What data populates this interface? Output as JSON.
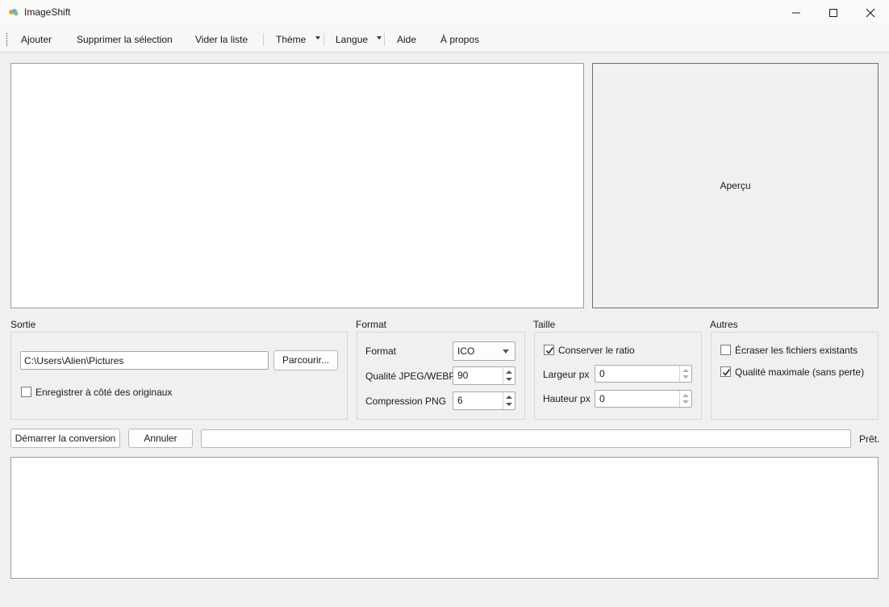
{
  "window": {
    "title": "ImageShift",
    "controls": [
      "minimize-icon",
      "maximize-icon",
      "close-icon"
    ]
  },
  "toolbar": {
    "add": "Ajouter",
    "remove_selection": "Supprimer la sélection",
    "clear_list": "Vider la liste",
    "theme": "Thème",
    "language": "Langue",
    "help": "Aide",
    "about": "À propos"
  },
  "preview": {
    "label": "Aperçu"
  },
  "output": {
    "group_label": "Sortie",
    "path": "C:\\Users\\Alien\\Pictures",
    "browse_label": "Parcourir...",
    "save_next_label": "Enregistrer à côté des originaux",
    "save_next_checked": false
  },
  "format": {
    "group_label": "Format",
    "format_label": "Format",
    "format_value": "ICO",
    "jpeg_quality_label": "Qualité JPEG/WEBP",
    "jpeg_quality_value": "90",
    "png_compression_label": "Compression PNG",
    "png_compression_value": "6"
  },
  "size": {
    "group_label": "Taille",
    "keep_ratio_label": "Conserver le ratio",
    "keep_ratio_checked": true,
    "width_label": "Largeur px",
    "width_value": "0",
    "height_label": "Hauteur px",
    "height_value": "0"
  },
  "other": {
    "group_label": "Autres",
    "overwrite_label": "Écraser les fichiers existants",
    "overwrite_checked": false,
    "max_quality_label": "Qualité maximale (sans perte)",
    "max_quality_checked": true
  },
  "actions": {
    "start_label": "Démarrer la conversion",
    "cancel_label": "Annuler",
    "progress_value": 0,
    "status": "Prêt."
  },
  "colors": {
    "window_bg": "#f0f0f0",
    "titlebar_bg": "#f9f9f7",
    "preview_bg": "#f2f1ef"
  }
}
